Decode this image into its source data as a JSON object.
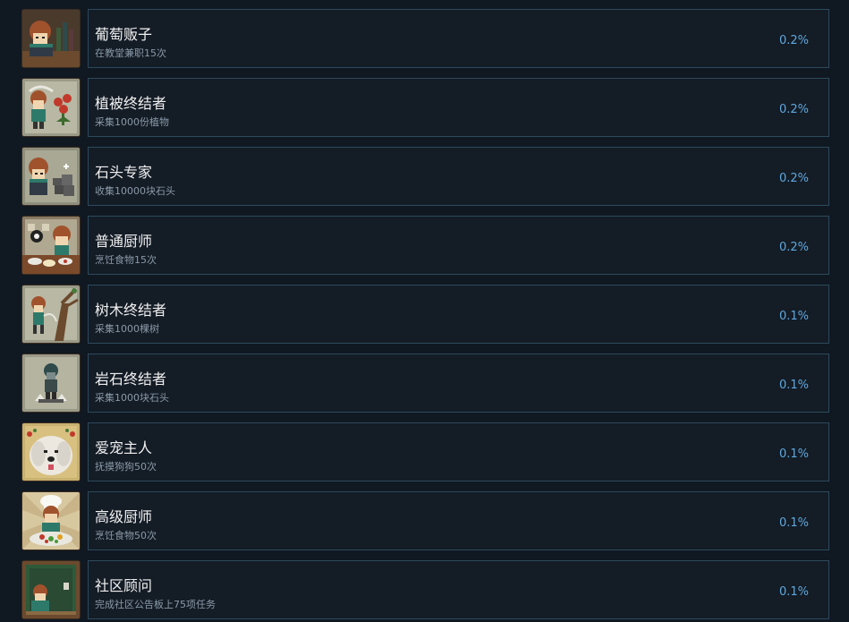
{
  "achievements": [
    {
      "title": "葡萄贩子",
      "desc": "在教堂兼职15次",
      "percent": "0.2%",
      "icon": "wine-merchant-icon"
    },
    {
      "title": "植被终结者",
      "desc": "采集1000份植物",
      "percent": "0.2%",
      "icon": "plant-terminator-icon"
    },
    {
      "title": "石头专家",
      "desc": "收集10000块石头",
      "percent": "0.2%",
      "icon": "stone-expert-icon"
    },
    {
      "title": "普通厨师",
      "desc": "烹饪食物15次",
      "percent": "0.2%",
      "icon": "ordinary-chef-icon"
    },
    {
      "title": "树木终结者",
      "desc": "采集1000棵树",
      "percent": "0.1%",
      "icon": "tree-terminator-icon"
    },
    {
      "title": "岩石终结者",
      "desc": "采集1000块石头",
      "percent": "0.1%",
      "icon": "rock-terminator-icon"
    },
    {
      "title": "爱宠主人",
      "desc": "抚摸狗狗50次",
      "percent": "0.1%",
      "icon": "pet-lover-icon"
    },
    {
      "title": "高级厨师",
      "desc": "烹饪食物50次",
      "percent": "0.1%",
      "icon": "senior-chef-icon"
    },
    {
      "title": "社区顾问",
      "desc": "完成社区公告板上75项任务",
      "percent": "0.1%",
      "icon": "community-advisor-icon"
    }
  ]
}
